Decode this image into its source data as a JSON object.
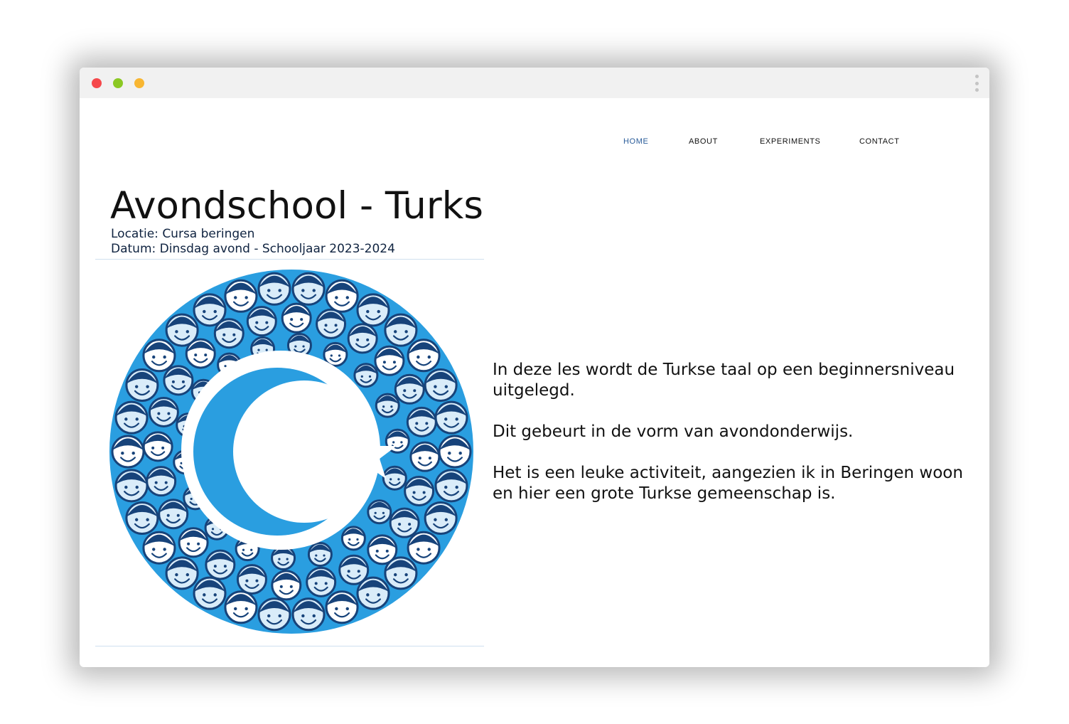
{
  "browser": {
    "controls": {
      "close_color": "#f5484b",
      "minimize_color": "#8bc823",
      "maximize_color": "#f8b632"
    },
    "menu_icon": "kebab-menu-icon"
  },
  "nav": {
    "items": [
      {
        "label": "HOME",
        "active": true
      },
      {
        "label": "ABOUT",
        "active": false
      },
      {
        "label": "EXPERIMENTS",
        "active": false
      },
      {
        "label": "CONTACT",
        "active": false
      }
    ],
    "active_color": "#2a5c9a"
  },
  "header": {
    "title": "Avondschool - Turks",
    "location": "Locatie: Cursa beringen",
    "date": "Datum: Dinsdag avond - Schooljaar 2023-2024"
  },
  "hero_image": {
    "subject": "turkish-flag-crescent-community-illustration",
    "colors": {
      "primary_blue": "#2a9ee0",
      "dark_blue": "#17437a",
      "white": "#ffffff"
    }
  },
  "description": {
    "paragraphs": [
      "In deze les wordt de Turkse taal op een beginnersniveau uitgelegd.",
      "Dit gebeurt in de vorm van avondonderwijs.",
      "Het is een leuke activiteit, aangezien ik in Beringen woon en hier een grote Turkse gemeenschap is."
    ]
  }
}
